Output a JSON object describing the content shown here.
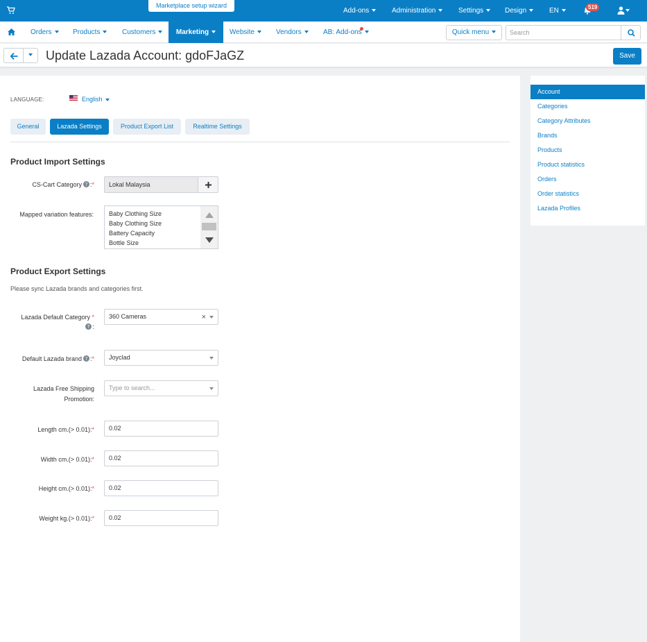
{
  "topbar": {
    "wizard_label": "Marketplace setup wizard",
    "menu": [
      {
        "label": "Add-ons"
      },
      {
        "label": "Administration"
      },
      {
        "label": "Settings"
      },
      {
        "label": "Design"
      },
      {
        "label": "EN"
      }
    ],
    "notifications_count": "519"
  },
  "nav": {
    "items": [
      {
        "label": "Orders"
      },
      {
        "label": "Products"
      },
      {
        "label": "Customers"
      },
      {
        "label": "Marketing"
      },
      {
        "label": "Website"
      },
      {
        "label": "Vendors"
      },
      {
        "label": "AB: Add-ons"
      }
    ],
    "active_index": 3,
    "quick_menu_label": "Quick menu",
    "search_placeholder": "Search"
  },
  "header": {
    "title": "Update Lazada Account: gdoFJaGZ",
    "save_label": "Save"
  },
  "language": {
    "label": "LANGUAGE:",
    "value": "English"
  },
  "tabs": [
    {
      "label": "General"
    },
    {
      "label": "Lazada Settings"
    },
    {
      "label": "Product Export List"
    },
    {
      "label": "Realtime Settings"
    }
  ],
  "active_tab": 1,
  "import_section": {
    "title": "Product Import Settings",
    "category_label": "CS-Cart Category",
    "category_value": "Lokal Malaysia",
    "mapped_label": "Mapped variation features:",
    "mapped_options": [
      "Baby Clothing Size",
      "Baby Clothing Size",
      "Battery Capacity",
      "Bottle Size"
    ]
  },
  "export_section": {
    "title": "Product Export Settings",
    "note": "Please sync Lazada brands and categories first.",
    "default_category_label": "Lazada Default Category",
    "default_category_value": "360 Cameras",
    "brand_label": "Default Lazada brand",
    "brand_value": "Joyclad",
    "shipping_label": "Lazada Free Shipping Promotion:",
    "shipping_placeholder": "Type to search...",
    "length_label": "Length cm.(> 0.01):",
    "length_value": "0.02",
    "width_label": "Width cm.(> 0.01):",
    "width_value": "0.02",
    "height_label": "Height cm.(> 0.01):",
    "height_value": "0.02",
    "weight_label": "Weight kg.(> 0.01):",
    "weight_value": "0.02"
  },
  "sidebar": {
    "items": [
      {
        "label": "Account"
      },
      {
        "label": "Categories"
      },
      {
        "label": "Category Attributes"
      },
      {
        "label": "Brands"
      },
      {
        "label": "Products"
      },
      {
        "label": "Product statistics"
      },
      {
        "label": "Orders"
      },
      {
        "label": "Order statistics"
      },
      {
        "label": "Lazada Profiles"
      }
    ],
    "active_index": 0
  },
  "colors": {
    "brand": "#0b7fc6",
    "required": "#d9534f",
    "badge": "#d9534f"
  }
}
